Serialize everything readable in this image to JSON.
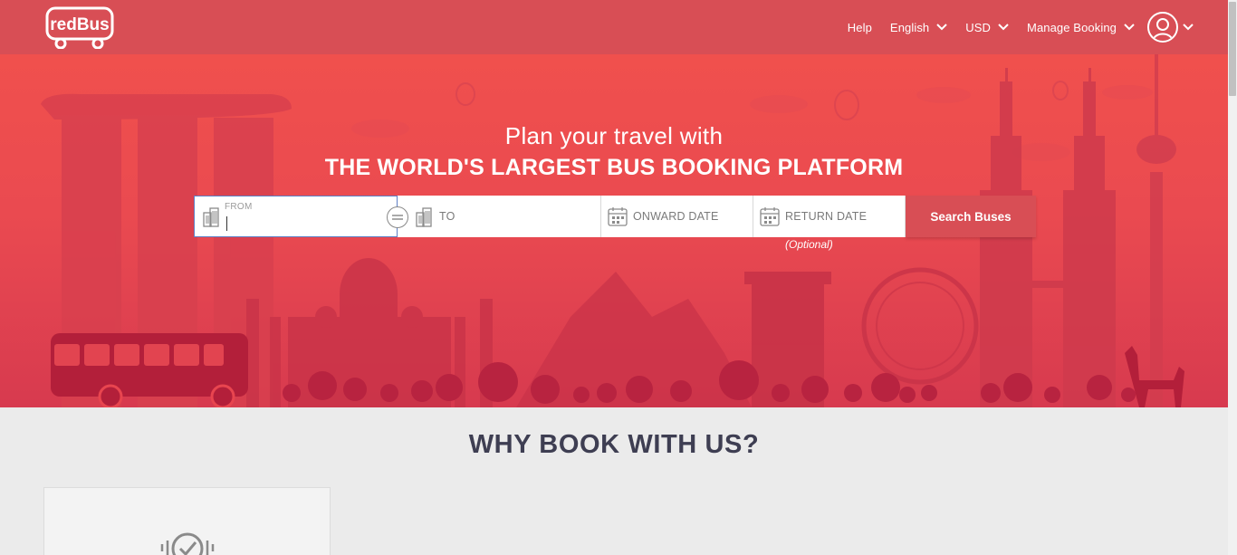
{
  "header": {
    "logo_text": "redBus",
    "nav": {
      "help": "Help",
      "language": "English",
      "currency": "USD",
      "manage_booking": "Manage Booking"
    }
  },
  "hero": {
    "title_line1": "Plan your travel with",
    "title_line2": "THE WORLD'S LARGEST BUS BOOKING PLATFORM"
  },
  "search": {
    "from_label": "FROM",
    "from_value": "",
    "to_label": "TO",
    "onward_label": "ONWARD DATE",
    "return_label": "RETURN DATE",
    "return_note": "(Optional)",
    "button_label": "Search Buses"
  },
  "why": {
    "title": "WHY BOOK WITH US?"
  },
  "colors": {
    "brand": "#d84e55",
    "hero": "#ea4a50",
    "dark_text": "#3e3e52"
  },
  "icons": {
    "from": "building-icon",
    "to": "building-icon",
    "date": "calendar-icon",
    "swap": "swap-icon",
    "user": "user-icon",
    "card": "verified-check-icon"
  }
}
